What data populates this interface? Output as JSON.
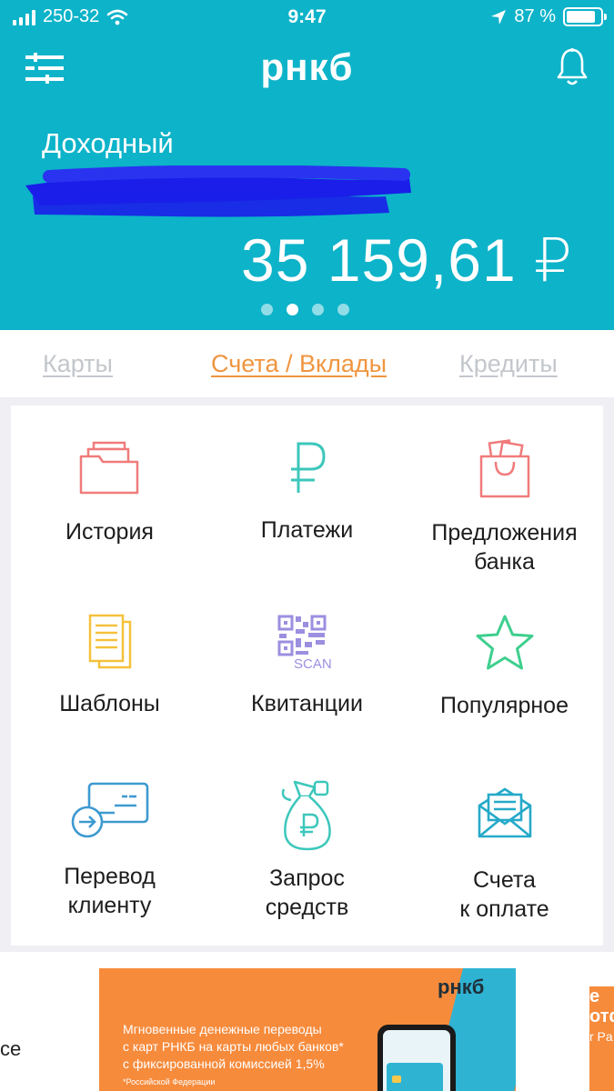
{
  "status_bar": {
    "carrier": "250-32",
    "time": "9:47",
    "battery": "87 %",
    "battery_level": 0.87
  },
  "header": {
    "logo": "рнкб",
    "account_name": "Доходный",
    "balance": "35 159,61 ₽",
    "carousel_count": 4,
    "carousel_active_index": 1
  },
  "tabs": [
    {
      "label": "Карты",
      "active": false
    },
    {
      "label": "Счета / Вклады",
      "active": true
    },
    {
      "label": "Кредиты",
      "active": false
    }
  ],
  "grid": [
    {
      "label_lines": [
        "История"
      ],
      "icon": "folder-icon",
      "color": "#f07b7b"
    },
    {
      "label_lines": [
        "Платежи"
      ],
      "icon": "ruble-icon",
      "color": "#3cc7bb"
    },
    {
      "label_lines": [
        "Предложения",
        "банка"
      ],
      "icon": "gift-bag-icon",
      "color": "#f07b7b"
    },
    {
      "label_lines": [
        "Шаблоны"
      ],
      "icon": "documents-icon",
      "color": "#f4c13b"
    },
    {
      "label_lines": [
        "Квитанции"
      ],
      "icon": "qr-scan-icon",
      "color": "#9b8fe0",
      "icon_text": "SCAN"
    },
    {
      "label_lines": [
        "Популярное"
      ],
      "icon": "star-icon",
      "color": "#3ecf8e"
    },
    {
      "label_lines": [
        "Перевод",
        "клиенту"
      ],
      "icon": "card-transfer-icon",
      "color": "#3d9ad1"
    },
    {
      "label_lines": [
        "Запрос",
        "средств"
      ],
      "icon": "money-bag-icon",
      "color": "#3cc7bb"
    },
    {
      "label_lines": [
        "Счета",
        "к оплате"
      ],
      "icon": "envelope-invoice-icon",
      "color": "#25a9c9"
    }
  ],
  "promo": {
    "left_partial_text": "се",
    "logo": "рнкб",
    "text_lines": [
      "Мгновенные денежные переводы",
      "с карт РНКБ на карты любых банков*",
      "с фиксированной комиссией 1,5%"
    ],
    "note": "*Российской Федерации",
    "right_partial_lines": [
      "е",
      "отф",
      "r Pa"
    ]
  },
  "colors": {
    "header_bg": "#0db3c9",
    "tab_active": "#f0953f",
    "tab_inactive": "#c3c7cc",
    "promo_bg": "#f68b3c",
    "redaction": "#1a1ee8"
  }
}
